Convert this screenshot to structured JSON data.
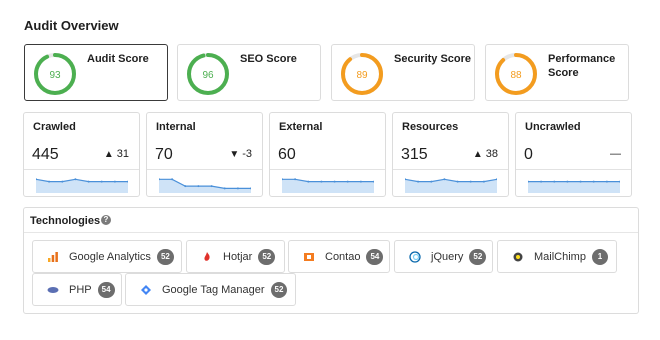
{
  "page_title": "Audit Overview",
  "scores": [
    {
      "label": "Audit Score",
      "value": 93,
      "color": "#4caf50"
    },
    {
      "label": "SEO Score",
      "value": 96,
      "color": "#4caf50"
    },
    {
      "label": "Security Score",
      "value": 89,
      "color": "#f39c1f"
    },
    {
      "label": "Performance Score",
      "value": 88,
      "color": "#f39c1f"
    }
  ],
  "metrics": [
    {
      "label": "Crawled",
      "value": "445",
      "delta": "31",
      "direction": "up",
      "trend": [
        6,
        5,
        5,
        6,
        5,
        5,
        5,
        5
      ]
    },
    {
      "label": "Internal",
      "value": "70",
      "delta": "-3",
      "direction": "down",
      "trend": [
        6,
        6,
        3,
        3,
        3,
        2,
        2,
        2
      ]
    },
    {
      "label": "External",
      "value": "60",
      "delta": "",
      "direction": "none",
      "trend": [
        6,
        6,
        5,
        5,
        5,
        5,
        5,
        5
      ]
    },
    {
      "label": "Resources",
      "value": "315",
      "delta": "38",
      "direction": "up",
      "trend": [
        6,
        5,
        5,
        6,
        5,
        5,
        5,
        6
      ]
    },
    {
      "label": "Uncrawled",
      "value": "0",
      "delta": "—",
      "direction": "flat",
      "trend": [
        5,
        5,
        5,
        5,
        5,
        5,
        5,
        5
      ]
    }
  ],
  "technologies": {
    "title": "Technologies",
    "help_icon": "question-circle-icon",
    "items": [
      {
        "name": "Google Analytics",
        "count": "52",
        "icon": "google-analytics-icon",
        "icon_color": "#e8711a"
      },
      {
        "name": "Hotjar",
        "count": "52",
        "icon": "hotjar-icon",
        "icon_color": "#e0322b"
      },
      {
        "name": "Contao",
        "count": "54",
        "icon": "contao-icon",
        "icon_color": "#f47c20"
      },
      {
        "name": "jQuery",
        "count": "52",
        "icon": "jquery-icon",
        "icon_color": "#0868ac"
      },
      {
        "name": "MailChimp",
        "count": "1",
        "icon": "mailchimp-icon",
        "icon_color": "#444444"
      },
      {
        "name": "PHP",
        "count": "54",
        "icon": "php-icon",
        "icon_color": "#5b6fb3"
      },
      {
        "name": "Google Tag Manager",
        "count": "52",
        "icon": "google-tag-manager-icon",
        "icon_color": "#4285f4"
      }
    ]
  },
  "colors": {
    "sparkline_line": "#4a90d9",
    "sparkline_fill": "#cfe3f7",
    "ring_track": "#e6e6e6"
  }
}
